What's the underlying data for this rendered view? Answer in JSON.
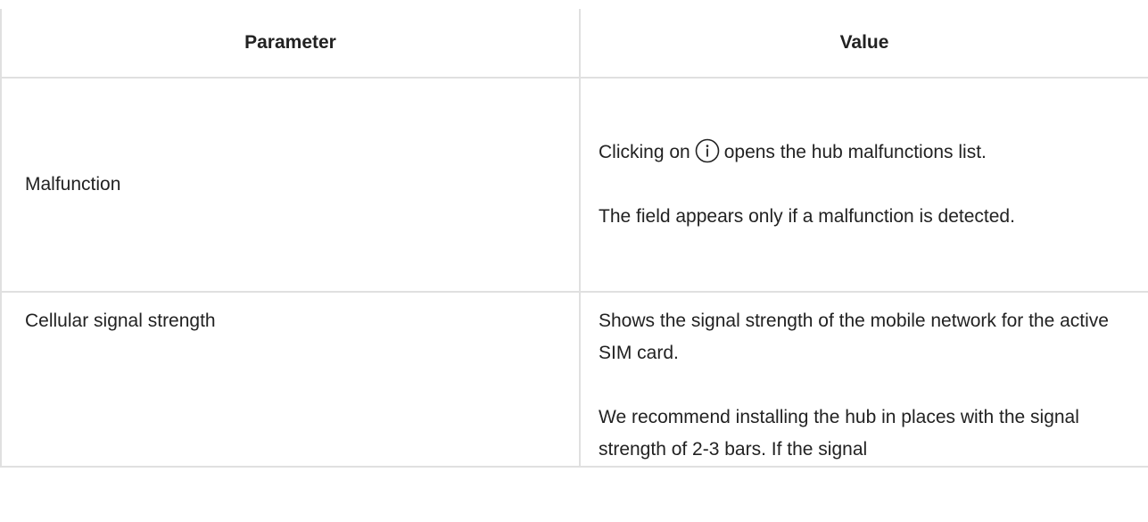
{
  "table": {
    "headers": {
      "parameter": "Parameter",
      "value": "Value"
    },
    "rows": [
      {
        "parameter": "Malfunction",
        "value_lines": {
          "p1_before": "Clicking on",
          "p1_icon": "info-circle-icon",
          "p1_after": "opens the hub malfunctions list.",
          "p2": "The field appears only if a malfunction is detected."
        }
      },
      {
        "parameter": "Cellular signal strength",
        "value_lines": {
          "p1": "Shows the signal strength of the mobile network for the active SIM card.",
          "p2": "We recommend installing the hub in places with the signal strength of 2-3 bars. If the signal"
        }
      }
    ]
  }
}
